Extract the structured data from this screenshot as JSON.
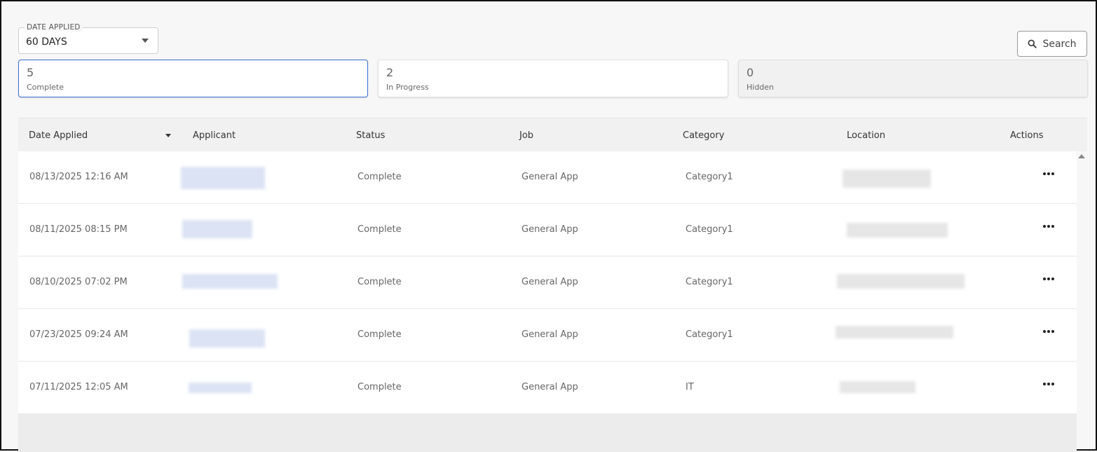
{
  "filter": {
    "label": "DATE APPLIED",
    "value": "60 DAYS"
  },
  "search": {
    "label": "Search"
  },
  "summary": [
    {
      "count": "5",
      "label": "Complete"
    },
    {
      "count": "2",
      "label": "In Progress"
    },
    {
      "count": "0",
      "label": "Hidden"
    }
  ],
  "table": {
    "headers": [
      "Date Applied",
      "Applicant",
      "Status",
      "Job",
      "Category",
      "Location",
      "Actions"
    ],
    "rows": [
      {
        "date": "08/13/2025 12:16 AM",
        "status": "Complete",
        "job": "General App",
        "category": "Category1"
      },
      {
        "date": "08/11/2025 08:15 PM",
        "status": "Complete",
        "job": "General App",
        "category": "Category1"
      },
      {
        "date": "08/10/2025 07:02 PM",
        "status": "Complete",
        "job": "General App",
        "category": "Category1"
      },
      {
        "date": "07/23/2025 09:24 AM",
        "status": "Complete",
        "job": "General App",
        "category": "Category1"
      },
      {
        "date": "07/11/2025 12:05 AM",
        "status": "Complete",
        "job": "General App",
        "category": "IT"
      }
    ]
  },
  "icons": {
    "search": "search-icon",
    "more": "more-horizontal-icon",
    "sort": "caret-down-icon",
    "dropdown": "chevron-down-icon"
  },
  "colors": {
    "accent": "#3b6fd1",
    "header_bg": "#f1f1f1",
    "page_bg": "#f7f7f7"
  }
}
